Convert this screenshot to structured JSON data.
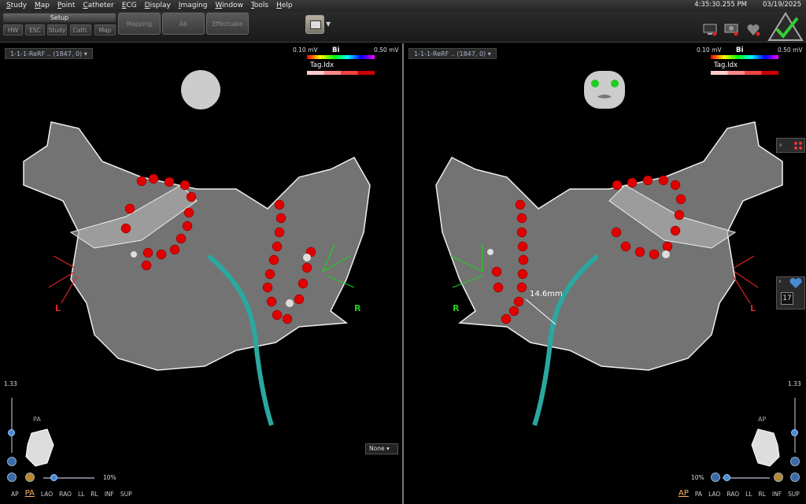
{
  "menu": [
    "Study",
    "Map",
    "Point",
    "Catheter",
    "ECG",
    "Display",
    "Imaging",
    "Window",
    "Tools",
    "Help"
  ],
  "clock": "4:35:30.255 PM",
  "date": "03/19/2025",
  "toolbar": {
    "setup": "Setup",
    "setup_tabs": [
      "HW",
      "ESC",
      "Study",
      "Cath.",
      "Map"
    ],
    "buttons": [
      "Mapping",
      "Ab",
      "Effectuate"
    ]
  },
  "left_view": {
    "map_name": "1-1-1-ReRF .. (1847, 0)",
    "legend_min": "0.10 mV",
    "legend_max": "0.50 mV",
    "legend_mode": "Bi",
    "tag_label": "Tag.Idx",
    "zoom_value": "1.33",
    "zoom_percent": "10%",
    "orientation": "PA",
    "views": [
      "AP",
      "PA",
      "LAO",
      "RAO",
      "LL",
      "RL",
      "INF",
      "SUP"
    ],
    "active_view": "PA",
    "label_left": "L",
    "label_right": "R",
    "none_select": "None"
  },
  "right_view": {
    "map_name": "1-1-1-ReRF .. (1847, 0)",
    "legend_min": "0.10 mV",
    "legend_max": "0.50 mV",
    "legend_mode": "Bi",
    "tag_label": "Tag.Idx",
    "zoom_value": "1.33",
    "zoom_percent": "10%",
    "orientation": "AP",
    "views": [
      "AP",
      "PA",
      "LAO",
      "RAO",
      "LL",
      "RL",
      "INF",
      "SUP"
    ],
    "active_view": "AP",
    "label_left": "R",
    "label_right": "L",
    "measurement": "14.6mm",
    "side_number": "17"
  },
  "colors": {
    "ablation": "#e00000",
    "catheter": "#2aa8a0",
    "shell": "#9a9a9a",
    "active_tab": "#ffb060"
  }
}
